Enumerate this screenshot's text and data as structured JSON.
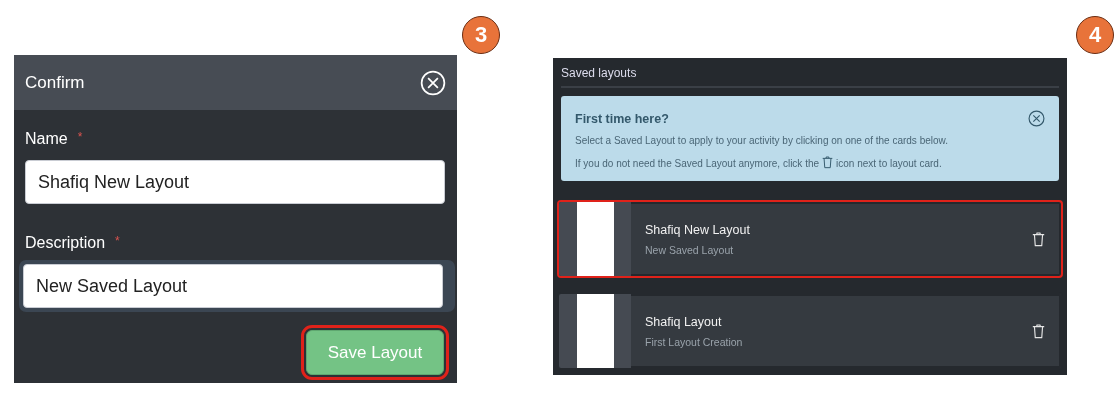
{
  "steps": [
    {
      "kind": "confirm",
      "badge": "3",
      "title": "Confirm",
      "fields": [
        {
          "label": "Name",
          "required_mark": "*",
          "value": "Shafiq New Layout",
          "focused": false
        },
        {
          "label": "Description",
          "required_mark": "*",
          "value": "New Saved Layout",
          "focused": true
        }
      ],
      "button": {
        "label": "Save Layout",
        "highlighted": true
      }
    },
    {
      "kind": "saved",
      "badge": "4",
      "title": "Saved layouts",
      "info": {
        "heading": "First time here?",
        "line_1": "Select a Saved Layout to apply to your activity by clicking on one of the cards below.",
        "line_2_before": "If you do not need the Saved Layout anymore, click the",
        "line_2_after": "icon next to layout card."
      },
      "cards": [
        {
          "name": "Shafiq New Layout",
          "description": "New Saved Layout",
          "highlighted": true
        },
        {
          "name": "Shafiq Layout",
          "description": "First Layout Creation",
          "highlighted": false
        }
      ]
    }
  ]
}
